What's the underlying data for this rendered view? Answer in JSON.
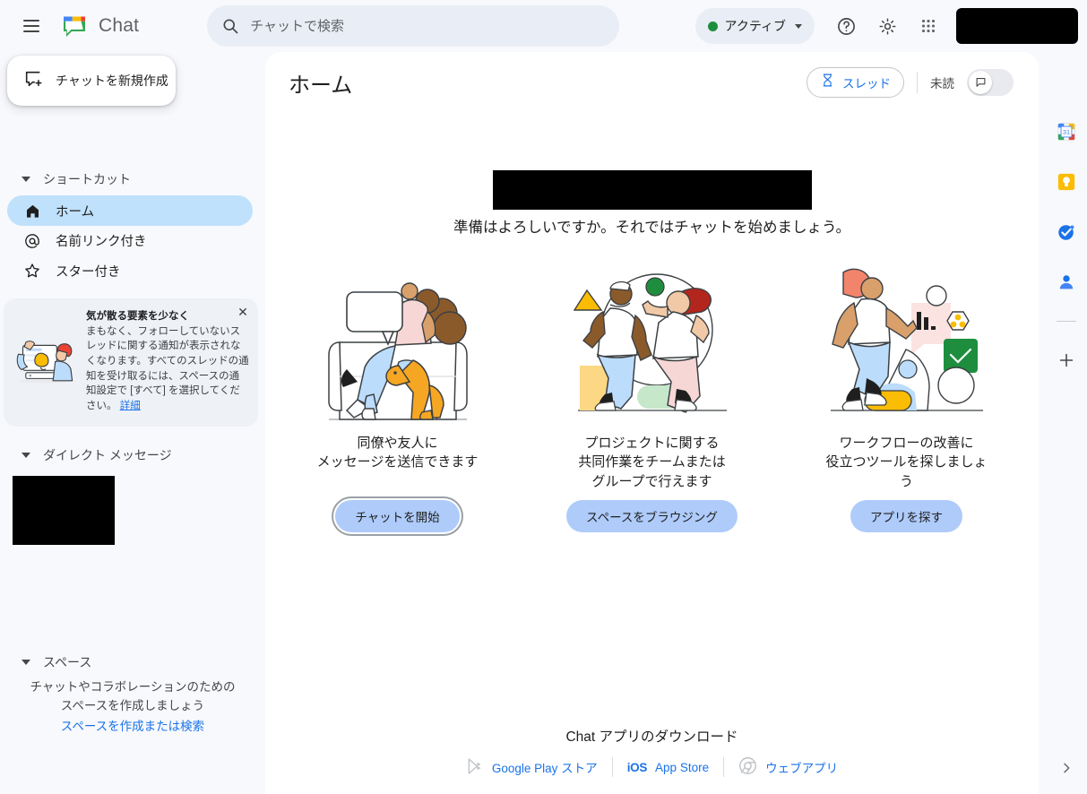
{
  "app": {
    "brand_name": "Chat",
    "logo_icon": "google-chat-logo",
    "menu_icon": "hamburger-menu-icon"
  },
  "search": {
    "placeholder": "チャットで検索",
    "value": "",
    "icon": "search-icon"
  },
  "status": {
    "label": "アクティブ",
    "dot_color": "#1e8e3e",
    "caret_icon": "chevron-down-icon"
  },
  "topbar_actions": [
    {
      "name": "help-icon",
      "glyph": "?"
    },
    {
      "name": "settings-gear-icon",
      "glyph": "gear"
    },
    {
      "name": "google-apps-grid-icon",
      "glyph": "grid"
    }
  ],
  "account": {
    "redacted": true
  },
  "sidebar": {
    "compose": {
      "label": "チャットを新規作成",
      "icon": "new-chat-icon"
    },
    "shortcuts": {
      "title": "ショートカット",
      "items": [
        {
          "label": "ホーム",
          "icon": "home-icon",
          "active": true
        },
        {
          "label": "名前リンク付き",
          "icon": "mention-at-icon",
          "active": false
        },
        {
          "label": "スター付き",
          "icon": "star-icon",
          "active": false
        }
      ]
    },
    "promo": {
      "title": "気が散る要素を少なく",
      "body": "まもなく、フォローしていないスレッドに関する通知が表示されなくなります。すべてのスレッドの通知を受け取るには、スペースの通知設定で [すべて] を選択してください。",
      "link": "詳細",
      "close_icon": "close-icon",
      "illustration": "person-with-bell-illustration"
    },
    "direct_messages": {
      "title": "ダイレクト メッセージ",
      "redacted_item": true
    },
    "spaces": {
      "title": "スペース",
      "empty_line1": "チャットやコラボレーションのための",
      "empty_line2": "スペースを作成しましょう",
      "empty_link": "スペースを作成または検索"
    }
  },
  "main": {
    "page_title": "ホーム",
    "thread_chip": {
      "label": "スレッド",
      "icon": "threads-filter-icon"
    },
    "unread": {
      "label": "未読",
      "toggle_on": false,
      "knob_icon": "unread-flag-icon"
    },
    "welcome": {
      "redacted_greeting": true,
      "subtitle": "準備はよろしいですか。それではチャットを始めましょう。"
    },
    "cards": [
      {
        "illustration": "person-on-chair-with-dog-illustration",
        "text": "同僚や友人に\nメッセージを送信できます",
        "text_line1": "同僚や友人に",
        "text_line2": "メッセージを送信できます",
        "button": "チャットを開始",
        "focused": true
      },
      {
        "illustration": "two-people-collaborating-illustration",
        "text_line1": "プロジェクトに関する",
        "text_line2": "共同作業をチームまたは",
        "text_line3": "グループで行えます",
        "button": "スペースをブラウジング",
        "focused": false
      },
      {
        "illustration": "person-with-tools-illustration",
        "text_line1": "ワークフローの改善に",
        "text_line2": "役立つツールを探しましょ",
        "text_line3": "う",
        "button": "アプリを探す",
        "focused": false
      }
    ],
    "download": {
      "title": "Chat アプリのダウンロード",
      "links": [
        {
          "label": "Google Play ストア",
          "icon": "google-play-icon"
        },
        {
          "label": "App Store",
          "icon": "ios-mark",
          "prefix": "iOS"
        },
        {
          "label": "ウェブアプリ",
          "icon": "chrome-icon"
        }
      ]
    }
  },
  "rail": {
    "apps": [
      {
        "name": "google-calendar-icon",
        "label": "31"
      },
      {
        "name": "google-keep-icon",
        "label": ""
      },
      {
        "name": "google-tasks-icon",
        "label": ""
      },
      {
        "name": "google-contacts-icon",
        "label": ""
      }
    ],
    "add_icon": "add-icon",
    "expand_icon": "chevron-right-icon"
  },
  "colors": {
    "accent_blue": "#1a73e8",
    "active_nav": "#bfe1fb",
    "button_blue": "#aecbfa",
    "page_bg": "#f8f9fd",
    "panel_bg": "#ffffff",
    "status_green": "#1e8e3e"
  }
}
